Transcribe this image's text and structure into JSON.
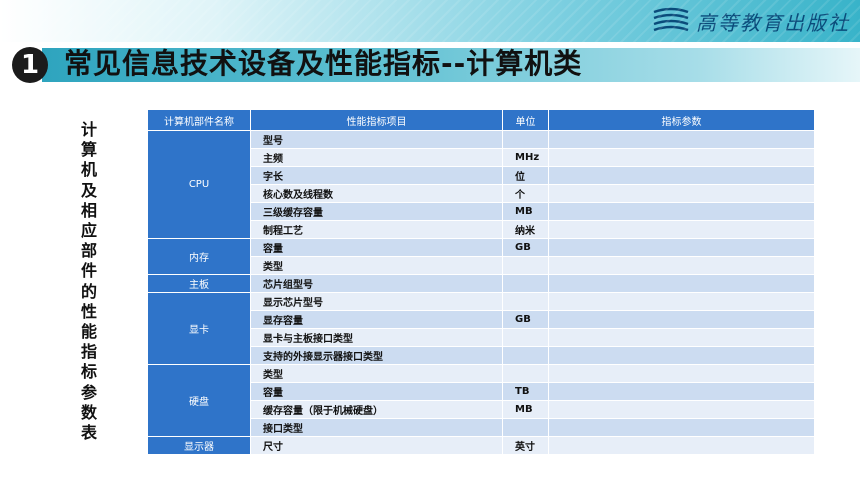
{
  "header": {
    "publisher": "高等教育出版社",
    "section_number": "1",
    "title": "常见信息技术设备及性能指标--计算机类"
  },
  "side_label": "计算机及相应部件的性能指标参数表",
  "table": {
    "columns": [
      "计算机部件名称",
      "性能指标项目",
      "单位",
      "指标参数"
    ],
    "groups": [
      {
        "name": "CPU",
        "rows": [
          {
            "item": "型号",
            "unit": "",
            "value": ""
          },
          {
            "item": "主频",
            "unit": "MHz",
            "value": ""
          },
          {
            "item": "字长",
            "unit": "位",
            "value": ""
          },
          {
            "item": "核心数及线程数",
            "unit": "个",
            "value": ""
          },
          {
            "item": "三级缓存容量",
            "unit": "MB",
            "value": ""
          },
          {
            "item": "制程工艺",
            "unit": "纳米",
            "value": ""
          }
        ]
      },
      {
        "name": "内存",
        "rows": [
          {
            "item": "容量",
            "unit": "GB",
            "value": ""
          },
          {
            "item": "类型",
            "unit": "",
            "value": ""
          }
        ]
      },
      {
        "name": "主板",
        "rows": [
          {
            "item": "芯片组型号",
            "unit": "",
            "value": ""
          }
        ]
      },
      {
        "name": "显卡",
        "rows": [
          {
            "item": "显示芯片型号",
            "unit": "",
            "value": ""
          },
          {
            "item": "显存容量",
            "unit": "GB",
            "value": ""
          },
          {
            "item": "显卡与主板接口类型",
            "unit": "",
            "value": ""
          },
          {
            "item": "支持的外接显示器接口类型",
            "unit": "",
            "value": ""
          }
        ]
      },
      {
        "name": "硬盘",
        "rows": [
          {
            "item": "类型",
            "unit": "",
            "value": ""
          },
          {
            "item": "容量",
            "unit": "TB",
            "value": ""
          },
          {
            "item": "缓存容量（限于机械硬盘）",
            "unit": "MB",
            "value": ""
          },
          {
            "item": "接口类型",
            "unit": "",
            "value": ""
          }
        ]
      },
      {
        "name": "显示器",
        "rows": [
          {
            "item": "尺寸",
            "unit": "英寸",
            "value": ""
          }
        ]
      }
    ]
  }
}
